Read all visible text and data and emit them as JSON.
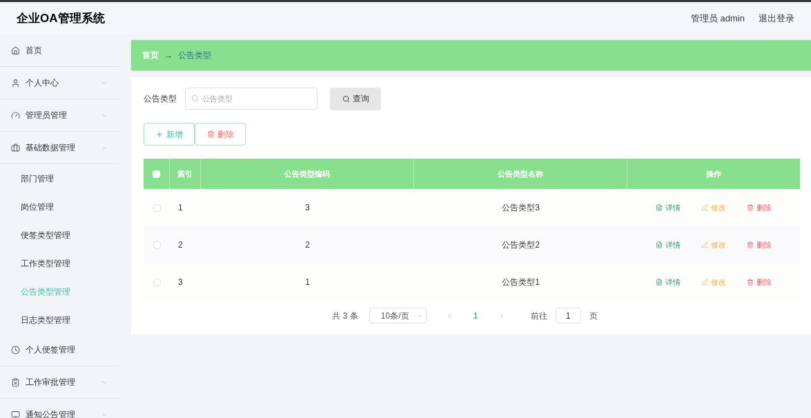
{
  "header": {
    "title": "企业OA管理系统",
    "user": "管理员 admin",
    "logout": "退出登录"
  },
  "sidebar": {
    "items": [
      {
        "label": "首页",
        "kind": "link"
      },
      {
        "label": "个人中心",
        "kind": "menu",
        "expanded": false
      },
      {
        "label": "管理员管理",
        "kind": "menu",
        "expanded": false
      },
      {
        "label": "基础数据管理",
        "kind": "menu",
        "expanded": true,
        "children": [
          {
            "label": "部门管理",
            "selected": false
          },
          {
            "label": "岗位管理",
            "selected": false
          },
          {
            "label": "便签类型管理",
            "selected": false
          },
          {
            "label": "工作类型管理",
            "selected": false
          },
          {
            "label": "公告类型管理",
            "selected": true
          },
          {
            "label": "日志类型管理",
            "selected": false
          }
        ]
      },
      {
        "label": "个人便签管理",
        "kind": "link"
      },
      {
        "label": "工作审批管理",
        "kind": "menu",
        "expanded": false
      },
      {
        "label": "通知公告管理",
        "kind": "menu",
        "expanded": false
      }
    ]
  },
  "breadcrumb": {
    "home": "首页",
    "arrow": "→",
    "current": "公告类型"
  },
  "search": {
    "label": "公告类型",
    "placeholder": "公告类型",
    "button": "查询"
  },
  "actions": {
    "add": "新增",
    "delete": "删除"
  },
  "table": {
    "columns": [
      "索引",
      "公告类型编码",
      "公告类型名称",
      "操作"
    ],
    "rows": [
      {
        "index": "1",
        "code": "3",
        "name": "公告类型3",
        "checked": false,
        "actions": {
          "detail": "详情",
          "edit": "修改",
          "delete": "删除"
        }
      },
      {
        "index": "2",
        "code": "2",
        "name": "公告类型2",
        "checked": false,
        "actions": {
          "detail": "详情",
          "edit": "修改",
          "delete": "删除"
        }
      },
      {
        "index": "3",
        "code": "1",
        "name": "公告类型1",
        "checked": false,
        "actions": {
          "detail": "详情",
          "edit": "修改",
          "delete": "删除"
        }
      }
    ],
    "select_all_checked": false
  },
  "pagination": {
    "total": "共 3 条",
    "page_size": "10条/页",
    "current_page": "1",
    "goto_label": "前往",
    "goto_value": "1",
    "page_suffix": "页"
  }
}
